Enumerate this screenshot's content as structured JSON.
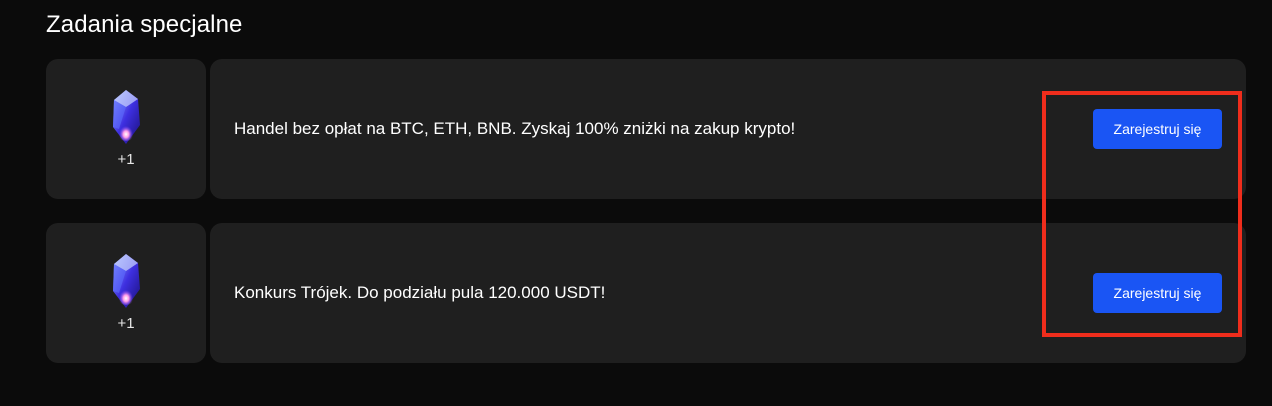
{
  "section": {
    "title": "Zadania specjalne"
  },
  "tasks": [
    {
      "reward": "+1",
      "reward_icon": "crystal-gem-icon",
      "description": "Handel bez opłat na BTC, ETH, BNB. Zyskaj 100% zniżki na zakup krypto!",
      "button_label": "Zarejestruj się"
    },
    {
      "reward": "+1",
      "reward_icon": "crystal-gem-icon",
      "description": "Konkurs Trójek. Do podziału pula 120.000 USDT!",
      "button_label": "Zarejestruj się"
    }
  ],
  "colors": {
    "background": "#0b0b0b",
    "card": "#1f1f1f",
    "button": "#1a55f4",
    "highlight": "#ef2d1c"
  }
}
